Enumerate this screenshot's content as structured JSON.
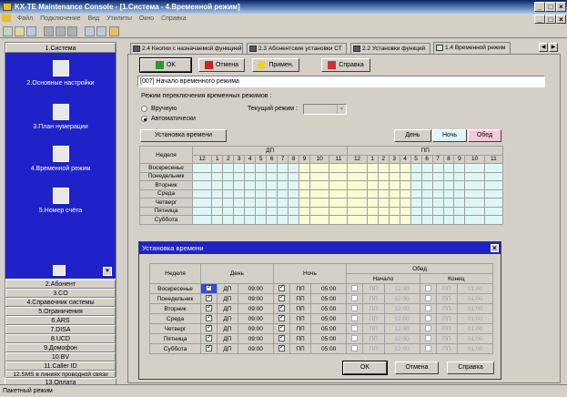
{
  "window": {
    "title": "KX-TE Maintenance Console - [1.Система - 4.Временной режим]"
  },
  "menu": [
    "Файл",
    "Подключение",
    "Вид",
    "Утилиты",
    "Окно",
    "Справка"
  ],
  "sidebar": {
    "header": "1.Система",
    "items": [
      {
        "label": "2.Основные настройки",
        "icon": "settings-icon"
      },
      {
        "label": "3.План нумерации",
        "icon": "numbering-icon"
      },
      {
        "label": "4.Временной режим",
        "icon": "clock-icon"
      },
      {
        "label": "5.Номер счёта",
        "icon": "account-icon"
      }
    ],
    "buttons": [
      "2.Абонент",
      "3.CO",
      "4.Справочник системы",
      "5.Ограничения",
      "6.ARS",
      "7.DISA",
      "8.UCD",
      "9.Домофон",
      "10.BV",
      "11.Caller ID",
      "12.SMS в линиях проводной связи",
      "13.Оплата"
    ]
  },
  "tabs": [
    "2.4 Кнопки с назначаемой функцией",
    "2.3 Абонентские установки СТ",
    "2.2 Установки функций",
    "1.4 Временной режим"
  ],
  "toolbar_buttons": {
    "ok": "OK",
    "cancel": "Отмена",
    "apply": "Примен.",
    "help": "Справка"
  },
  "section_label": "[007] Начало временного режима",
  "mode": {
    "label": "Режим переключения временных режимов :",
    "manual": "Вручную",
    "auto": "Автоматически",
    "current_label": "Текущий режим :",
    "current_value": "",
    "selected": "auto"
  },
  "time_setup_button": "Установка времени",
  "legend": {
    "day": "День",
    "night": "Ночь",
    "lunch": "Обед",
    "colors": {
      "day": "#dff6f6",
      "night": "#fbfbd4",
      "lunch": "#f8c8d8"
    }
  },
  "grid": {
    "week_label": "Неделя",
    "am": "ДП",
    "pm": "ПП",
    "hours": [
      "12",
      "1",
      "2",
      "3",
      "4",
      "5",
      "6",
      "7",
      "8",
      "9",
      "10",
      "11"
    ],
    "days": [
      "Воскресенье",
      "Понедельник",
      "Вторник",
      "Среда",
      "Четверг",
      "Пятница",
      "Суббота"
    ]
  },
  "dialog": {
    "title": "Установка времени",
    "headers": {
      "week": "Неделя",
      "day": "День",
      "night": "Ночь",
      "lunch": "Обед",
      "start": "Начало",
      "end": "Конец"
    },
    "rows": [
      {
        "day": "Воскресенье",
        "day_on": true,
        "day_ampm": "ДП",
        "day_time": "09:00",
        "night_on": true,
        "night_ampm": "ПП",
        "night_time": "05:00",
        "ls_ampm": "ПП",
        "ls_time": "12:00",
        "le_ampm": "ПП",
        "le_time": "01:00"
      },
      {
        "day": "Понедельник",
        "day_on": true,
        "day_ampm": "ДП",
        "day_time": "09:00",
        "night_on": true,
        "night_ampm": "ПП",
        "night_time": "05:00",
        "ls_ampm": "ПП",
        "ls_time": "12:00",
        "le_ampm": "ПП",
        "le_time": "01:00"
      },
      {
        "day": "Вторник",
        "day_on": true,
        "day_ampm": "ДП",
        "day_time": "09:00",
        "night_on": true,
        "night_ampm": "ПП",
        "night_time": "05:00",
        "ls_ampm": "ПП",
        "ls_time": "12:00",
        "le_ampm": "ПП",
        "le_time": "01:00"
      },
      {
        "day": "Среда",
        "day_on": true,
        "day_ampm": "ДП",
        "day_time": "09:00",
        "night_on": true,
        "night_ampm": "ПП",
        "night_time": "05:00",
        "ls_ampm": "ПП",
        "ls_time": "12:00",
        "le_ampm": "ПП",
        "le_time": "01:00"
      },
      {
        "day": "Четверг",
        "day_on": true,
        "day_ampm": "ДП",
        "day_time": "09:00",
        "night_on": true,
        "night_ampm": "ПП",
        "night_time": "05:00",
        "ls_ampm": "ПП",
        "ls_time": "12:00",
        "le_ampm": "ПП",
        "le_time": "01:00"
      },
      {
        "day": "Пятница",
        "day_on": true,
        "day_ampm": "ДП",
        "day_time": "09:00",
        "night_on": true,
        "night_ampm": "ПП",
        "night_time": "05:00",
        "ls_ampm": "ПП",
        "ls_time": "12:00",
        "le_ampm": "ПП",
        "le_time": "01:00"
      },
      {
        "day": "Суббота",
        "day_on": true,
        "day_ampm": "ДП",
        "day_time": "09:00",
        "night_on": true,
        "night_ampm": "ПП",
        "night_time": "05:00",
        "ls_ampm": "ПП",
        "ls_time": "12:00",
        "le_ampm": "ПП",
        "le_time": "01:00"
      }
    ],
    "buttons": {
      "ok": "OK",
      "cancel": "Отмена",
      "help": "Справка"
    }
  },
  "status": "Пакетный режим"
}
